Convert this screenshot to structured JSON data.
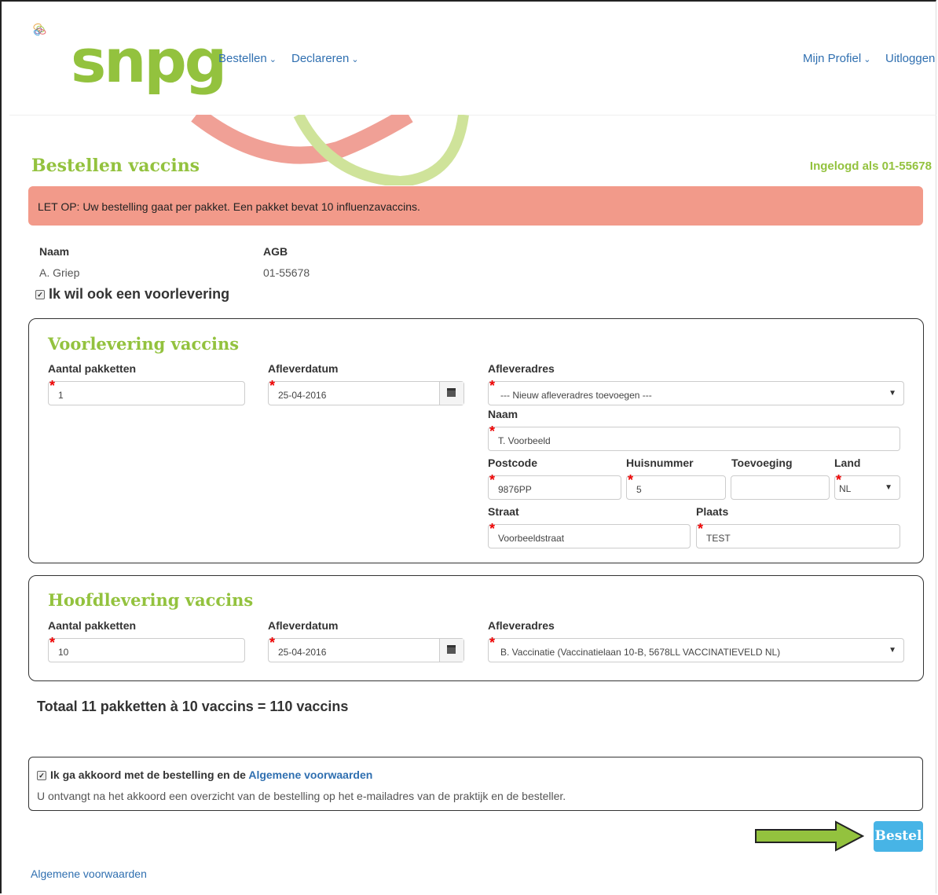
{
  "header": {
    "logo_text": "snpg",
    "nav_left": [
      "Bestellen",
      "Declareren"
    ],
    "nav_profile": "Mijn Profiel",
    "nav_logout": "Uitloggen"
  },
  "page": {
    "title": "Bestellen vaccins",
    "logged_in": "Ingelogd als 01-55678",
    "alert": "LET OP: Uw bestelling gaat per pakket. Een pakket bevat 10 influenzavaccins."
  },
  "info": {
    "naam_label": "Naam",
    "naam_value": "A. Griep",
    "agb_label": "AGB",
    "agb_value": "01-55678",
    "voorlevering_check": "Ik wil ook een voorlevering"
  },
  "voorlevering": {
    "title": "Voorlevering vaccins",
    "aantal_label": "Aantal pakketten",
    "aantal_value": "1",
    "datum_label": "Afleverdatum",
    "datum_value": "25-04-2016",
    "adres_label": "Afleveradres",
    "adres_value": "--- Nieuw afleveradres toevoegen ---",
    "naam_label": "Naam",
    "naam_value": "T. Voorbeeld",
    "postcode_label": "Postcode",
    "postcode_value": "9876PP",
    "huisnummer_label": "Huisnummer",
    "huisnummer_value": "5",
    "toevoeging_label": "Toevoeging",
    "toevoeging_value": "",
    "land_label": "Land",
    "land_value": "NL",
    "straat_label": "Straat",
    "straat_value": "Voorbeeldstraat",
    "plaats_label": "Plaats",
    "plaats_value": "TEST"
  },
  "hoofdlevering": {
    "title": "Hoofdlevering vaccins",
    "aantal_label": "Aantal pakketten",
    "aantal_value": "10",
    "datum_label": "Afleverdatum",
    "datum_value": "25-04-2016",
    "adres_label": "Afleveradres",
    "adres_value": "B. Vaccinatie (Vaccinatielaan 10-B, 5678LL VACCINATIEVELD NL)"
  },
  "total": "Totaal 11 pakketten à 10 vaccins = 110 vaccins",
  "agreement": {
    "text": "Ik ga akkoord met de bestelling en de",
    "link": "Algemene voorwaarden",
    "note": "U ontvangt na het akkoord een overzicht van de bestelling op het e-mailadres van de praktijk en de besteller."
  },
  "submit_label": "Bestel",
  "footer_link": "Algemene voorwaarden",
  "colors": {
    "brand_green": "#93c23e",
    "link_blue": "#2f6fb0",
    "alert_red": "#f29a8a",
    "button_blue": "#47b4e6"
  }
}
